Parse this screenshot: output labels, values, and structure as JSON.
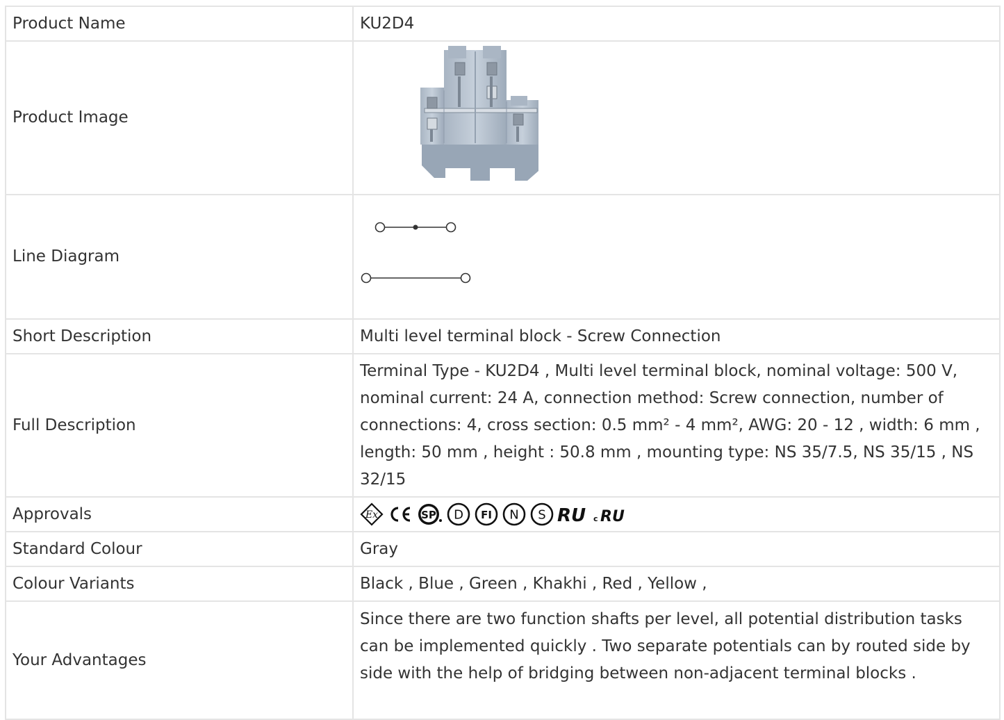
{
  "spec": {
    "product_name": {
      "label": "Product Name",
      "value": "KU2D4"
    },
    "product_image": {
      "label": "Product Image"
    },
    "line_diagram": {
      "label": "Line Diagram"
    },
    "short_description": {
      "label": "Short Description",
      "value": "Multi level terminal block - Screw Connection"
    },
    "full_description": {
      "label": "Full Description",
      "value": "Terminal Type - KU2D4 , Multi level terminal block, nominal voltage: 500 V, nominal current: 24 A, connection method: Screw connection, number of connections: 4, cross section: 0.5 mm² - 4 mm², AWG: 20 - 12 , width: 6 mm , length: 50 mm , height : 50.8 mm , mounting type: NS 35/7.5,  NS 35/15 , NS 32/15"
    },
    "approvals": {
      "label": "Approvals",
      "icons": [
        "ex-icon",
        "ce-icon",
        "csa-icon",
        "demko-icon",
        "fimko-icon",
        "nemko-icon",
        "semko-icon",
        "ur-icon",
        "cur-icon"
      ]
    },
    "standard_colour": {
      "label": "Standard Colour",
      "value": "Gray"
    },
    "colour_variants": {
      "label": "Colour Variants",
      "value": "Black , Blue , Green , Khakhi , Red , Yellow ,"
    },
    "advantages": {
      "label": "Your Advantages",
      "value": "Since there are two function shafts per level, all potential distribution tasks can be implemented quickly . Two separate potentials can by routed side by side with the help of bridging between non-adjacent terminal blocks ."
    }
  },
  "colors": {
    "border": "#e4e4e4",
    "text": "#333333",
    "product": "#b9c4d0"
  }
}
